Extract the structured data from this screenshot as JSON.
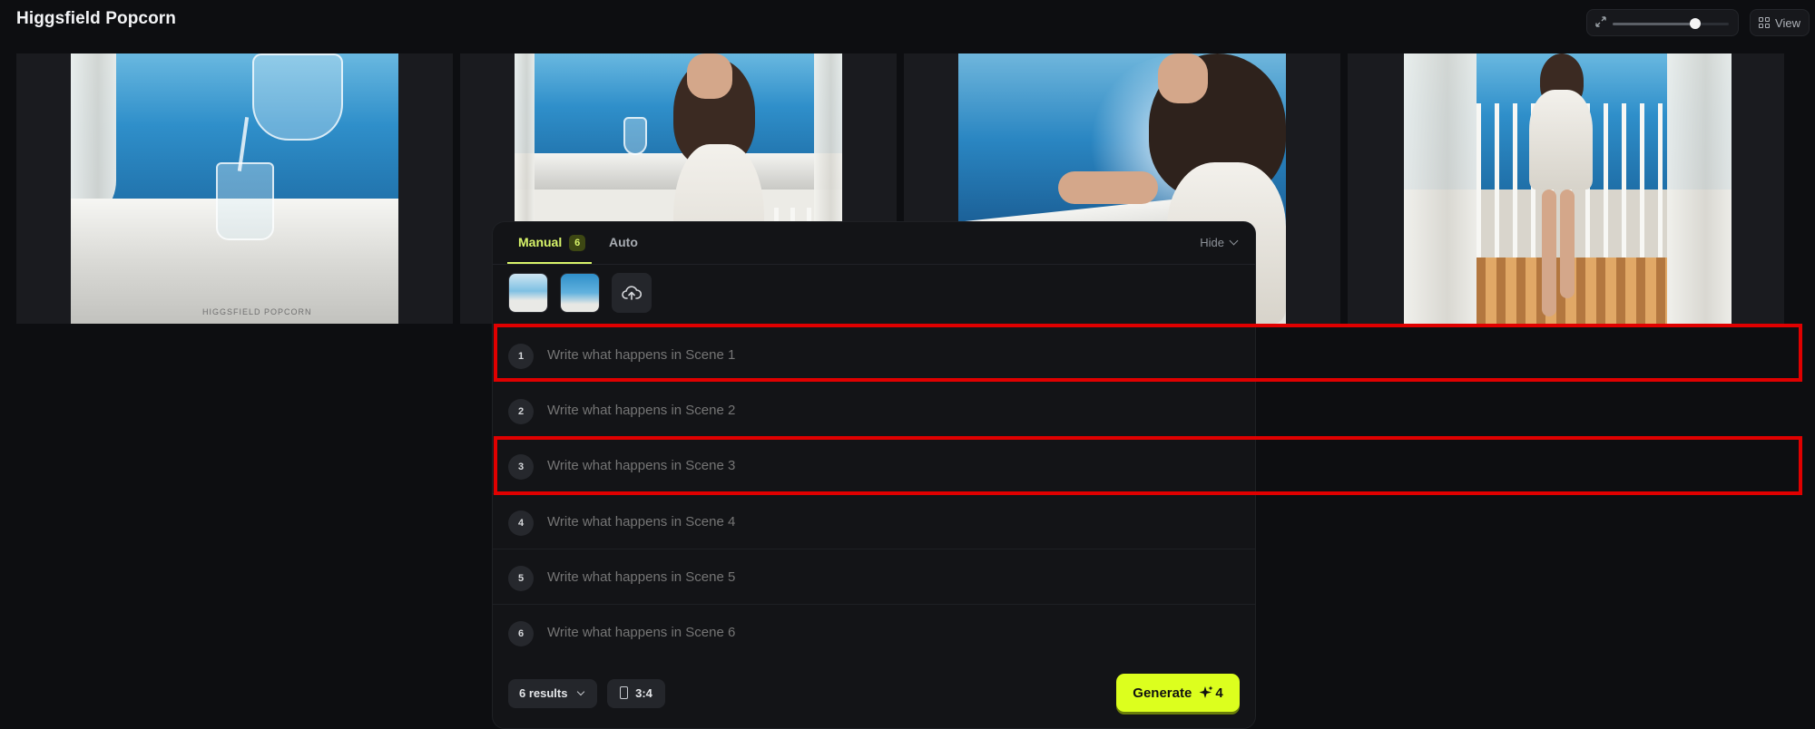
{
  "app": {
    "title": "Higgsfield Popcorn"
  },
  "toolbar": {
    "zoom_level": 0.71,
    "view_label": "View"
  },
  "gallery": {
    "images": [
      {
        "alt": "",
        "watermark": "HIGGSFIELD POPCORN"
      },
      {
        "alt": ""
      },
      {
        "alt": ""
      },
      {
        "alt": ""
      }
    ]
  },
  "panel": {
    "tabs": [
      {
        "label": "Manual",
        "badge": "6",
        "active": true
      },
      {
        "label": "Auto",
        "active": false
      }
    ],
    "hide_label": "Hide",
    "scenes": [
      {
        "number": "1",
        "placeholder": "Write what happens in Scene 1"
      },
      {
        "number": "2",
        "placeholder": "Write what happens in Scene 2"
      },
      {
        "number": "3",
        "placeholder": "Write what happens in Scene 3"
      },
      {
        "number": "4",
        "placeholder": "Write what happens in Scene 4"
      },
      {
        "number": "5",
        "placeholder": "Write what happens in Scene 5"
      },
      {
        "number": "6",
        "placeholder": "Write what happens in Scene 6"
      }
    ],
    "results_label": "6 results",
    "aspect_ratio": "3:4",
    "generate": {
      "label": "Generate",
      "cost": "4"
    }
  },
  "colors": {
    "accent": "#dcff1e",
    "highlight": "#e00000",
    "background": "#0d0e11"
  }
}
